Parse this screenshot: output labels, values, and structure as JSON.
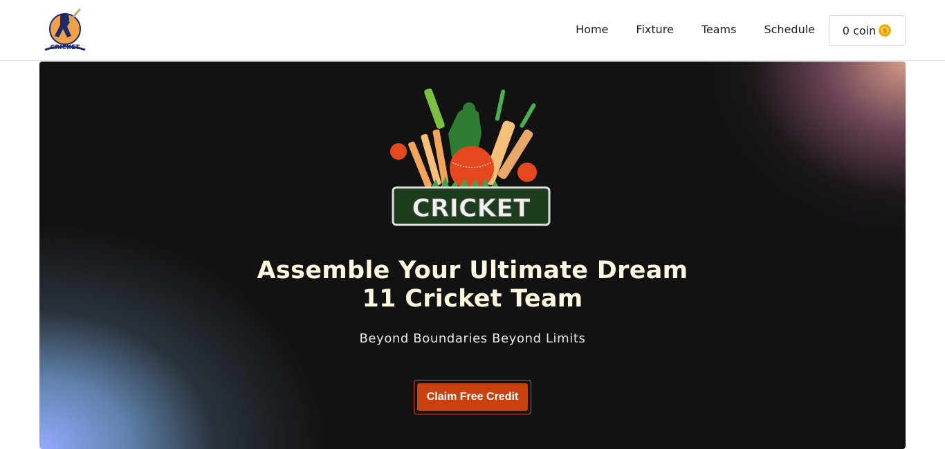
{
  "logo": {
    "text": "CRICKET",
    "icon": "batsman-logo-icon"
  },
  "nav": {
    "items": [
      {
        "label": "Home"
      },
      {
        "label": "Fixture"
      },
      {
        "label": "Teams"
      },
      {
        "label": "Schedule"
      }
    ],
    "coin_label": "0 coin",
    "coin_icon": "gold-coin-icon"
  },
  "hero": {
    "emblem_text": "CRICKET",
    "emblem_icon": "cricket-emblem-icon",
    "headline_line1": "Assemble Your Ultimate Dream",
    "headline_line2": "11 Cricket Team",
    "tagline": "Beyond Boundaries Beyond Limits",
    "cta_label": "Claim Free Credit"
  },
  "colors": {
    "cta": "#c9410f",
    "headline": "#fff8e1",
    "hero_bg": "#121212",
    "emblem_green": "#2e7d32"
  }
}
